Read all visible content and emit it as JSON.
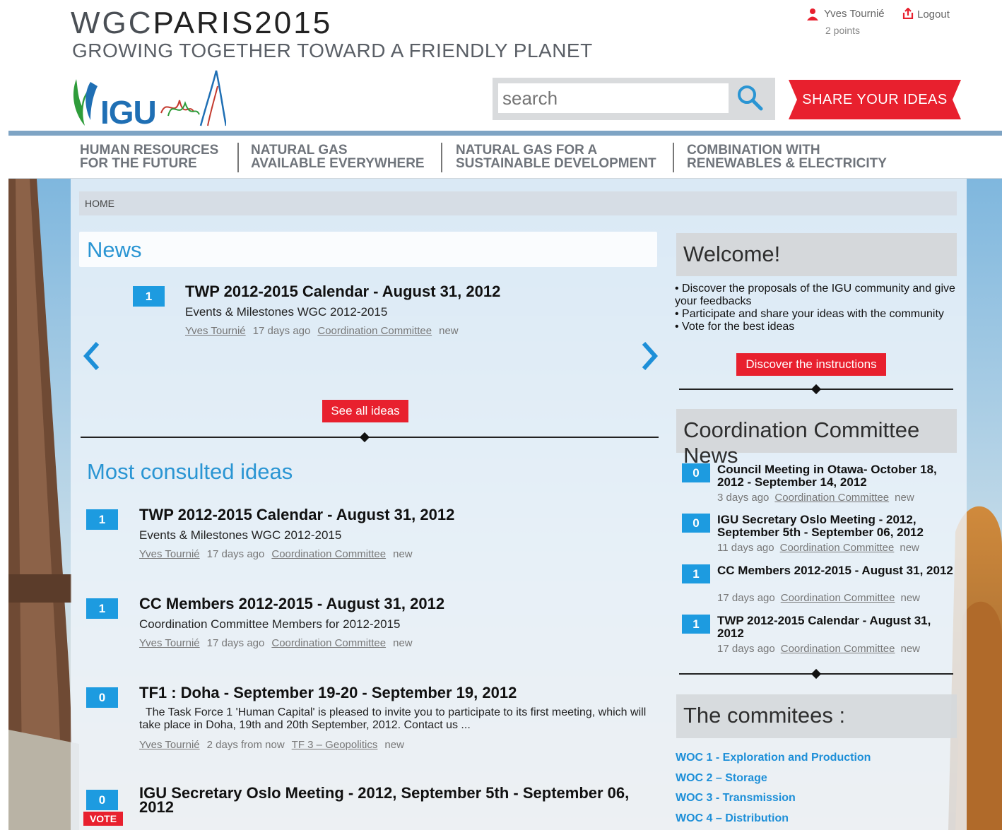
{
  "header": {
    "brand_prefix": "WGC",
    "brand_suffix": "PARIS2015",
    "tagline": "GROWING TOGETHER TOWARD A FRIENDLY PLANET",
    "logo_text": "IGU",
    "user_name": "Yves Tournié",
    "user_points": "2 points",
    "logout_label": "Logout",
    "search_placeholder": "search",
    "share_label": "SHARE YOUR IDEAS"
  },
  "nav": [
    {
      "label": "HUMAN RESOURCES\nFOR THE FUTURE"
    },
    {
      "label": "NATURAL GAS\nAVAILABLE EVERYWHERE"
    },
    {
      "label": "NATURAL GAS FOR A\nSUSTAINABLE DEVELOPMENT"
    },
    {
      "label": "COMBINATION WITH\nRENEWABLES & ELECTRICITY"
    }
  ],
  "breadcrumb": "HOME",
  "news": {
    "title": "News",
    "item": {
      "votes": "1",
      "title": "TWP 2012-2015 Calendar - August 31, 2012",
      "subtitle": "Events & Milestones WGC 2012-2015",
      "author": "Yves Tournié",
      "time": "17 days ago",
      "committee": "Coordination Committee",
      "status": "new"
    },
    "see_all_label": "See all ideas"
  },
  "most_consulted": {
    "title": "Most consulted ideas",
    "items": [
      {
        "votes": "1",
        "title": "TWP 2012-2015 Calendar - August 31, 2012",
        "subtitle": "Events & Milestones WGC 2012-2015",
        "author": "Yves Tournié",
        "time": "17 days ago",
        "committee": "Coordination Committee",
        "status": "new"
      },
      {
        "votes": "1",
        "title": "CC Members 2012-2015 - August 31, 2012",
        "subtitle": "Coordination Committee Members for 2012-2015",
        "author": "Yves Tournié",
        "time": "17 days ago",
        "committee": "Coordination Committee",
        "status": "new"
      },
      {
        "votes": "0",
        "title": "TF1 : Doha - September 19-20 - September 19, 2012",
        "subtitle": "  The Task Force 1 'Human Capital' is pleased to invite you to participate to its first meeting, which will take place in Doha, 19th and 20th September, 2012. Contact us ...",
        "author": "Yves Tournié",
        "time": "2 days from now",
        "committee": "TF 3 – Geopolitics",
        "status": "new"
      },
      {
        "votes": "0",
        "title": "IGU Secretary Oslo Meeting - 2012, September 5th - September 06, 2012",
        "vote_label": "VOTE"
      }
    ]
  },
  "welcome": {
    "title": "Welcome!",
    "bullets": [
      "Discover the proposals of the IGU community and give your feedbacks",
      "Participate and share your ideas with the community",
      "Vote for the best ideas"
    ],
    "button_label": "Discover the instructions"
  },
  "cc_news": {
    "title": "Coordination Committee News",
    "items": [
      {
        "votes": "0",
        "title": "Council Meeting in Otawa- October 18, 2012 - September 14, 2012",
        "time": "3 days ago",
        "committee": "Coordination Committee",
        "status": "new"
      },
      {
        "votes": "0",
        "title": "IGU Secretary Oslo Meeting - 2012, September 5th - September 06, 2012",
        "time": "11 days ago",
        "committee": "Coordination Committee",
        "status": "new"
      },
      {
        "votes": "1",
        "title": "CC Members 2012-2015 - August 31, 2012",
        "time": "17 days ago",
        "committee": "Coordination Committee",
        "status": "new"
      },
      {
        "votes": "1",
        "title": "TWP 2012-2015 Calendar - August 31, 2012",
        "time": "17 days ago",
        "committee": "Coordination Committee",
        "status": "new"
      }
    ]
  },
  "committees": {
    "title": "The commitees :",
    "items": [
      "WOC 1 - Exploration and Production",
      "WOC 2 – Storage",
      "WOC 3 - Transmission",
      "WOC 4 – Distribution"
    ]
  },
  "colors": {
    "accent_blue": "#2a95d3",
    "badge_blue": "#1d9be0",
    "cta_red": "#e8202e"
  }
}
